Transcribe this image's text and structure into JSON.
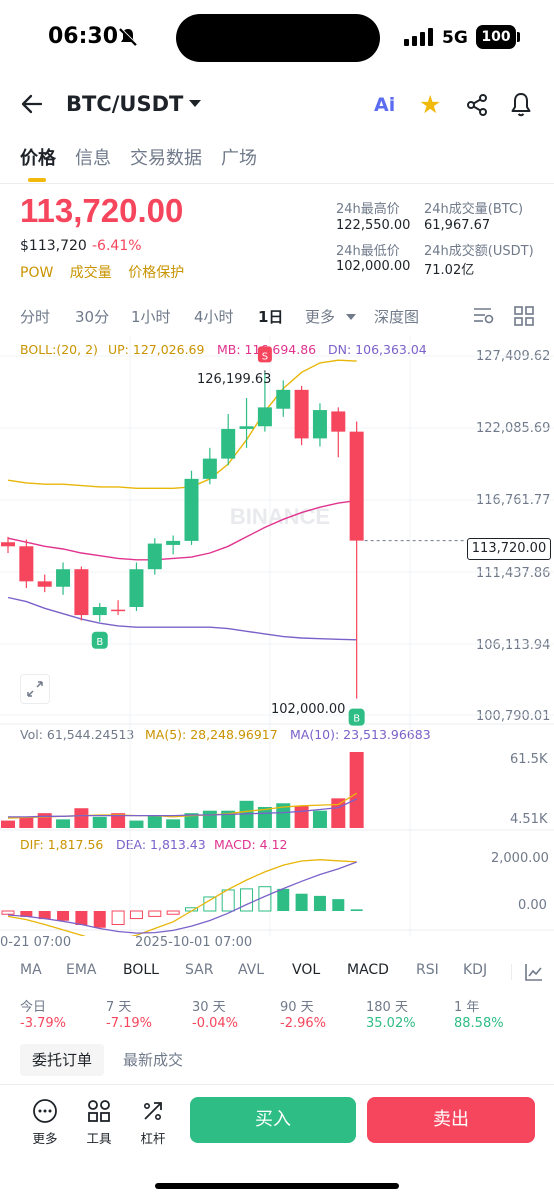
{
  "status_bar": {
    "time": "06:30",
    "network": "5G",
    "battery": "100"
  },
  "header": {
    "pair": "BTC/USDT",
    "ai_label": "Ai"
  },
  "tabs": [
    "价格",
    "信息",
    "交易数据",
    "广场"
  ],
  "price": {
    "last": "113,720.00",
    "usd": "$113,720",
    "change": "-6.41%",
    "tags": [
      "POW",
      "成交量",
      "价格保护"
    ]
  },
  "stats": {
    "high_label": "24h最高价",
    "high": "122,550.00",
    "vol_btc_label": "24h成交量(BTC)",
    "vol_btc": "61,967.67",
    "low_label": "24h最低价",
    "low": "102,000.00",
    "vol_usdt_label": "24h成交额(USDT)",
    "vol_usdt": "71.02亿"
  },
  "intervals": [
    "分时",
    "30分",
    "1小时",
    "4小时",
    "1日",
    "更多",
    "深度图"
  ],
  "active_interval": "1日",
  "boll": {
    "params": "BOLL:(20, 2)",
    "up": "UP: 127,026.69",
    "mb": "MB: 116,694.86",
    "dn": "DN: 106,363.04"
  },
  "vol_legend": {
    "vol": "Vol: 61,544.24513",
    "ma5": "MA(5): 28,248.96917",
    "ma10": "MA(10): 23,513.96683"
  },
  "macd_legend": {
    "dif": "DIF: 1,817.56",
    "dea": "DEA: 1,813.43",
    "macd": "MACD: 4.12"
  },
  "price_axis": [
    "127,409.62",
    "122,085.69",
    "116,761.77",
    "111,437.86",
    "106,113.94",
    "100,790.01"
  ],
  "current_price_tag": "113,720.00",
  "high_marker": "126,199.63",
  "low_marker": "102,000.00",
  "vol_axis": [
    "61.5K",
    "4.51K"
  ],
  "macd_axis": [
    "2,000.00",
    "0.00"
  ],
  "time_axis": [
    "0-21 07:00",
    "2025-10-01 07:00"
  ],
  "watermark": "BINANCE",
  "buy_marker": "B",
  "sell_marker": "S",
  "indicator_tabs": [
    "MA",
    "EMA",
    "BOLL",
    "SAR",
    "AVL",
    "VOL",
    "MACD",
    "RSI",
    "KDJ"
  ],
  "performance": [
    {
      "label": "今日",
      "value": "-3.79%"
    },
    {
      "label": "7 天",
      "value": "-7.19%"
    },
    {
      "label": "30 天",
      "value": "-0.04%"
    },
    {
      "label": "90 天",
      "value": "-2.96%"
    },
    {
      "label": "180 天",
      "value": "35.02%"
    },
    {
      "label": "1 年",
      "value": "88.58%"
    }
  ],
  "order_tabs": [
    "委托订单",
    "最新成交"
  ],
  "tools": [
    "更多",
    "工具",
    "杠杆"
  ],
  "buy": "买入",
  "sell": "卖出",
  "colors": {
    "up": "#2ebd85",
    "down": "#f6465d",
    "accent": "#f0b90b",
    "boll_up": "#e8b608",
    "boll_mb": "#e0338f",
    "boll_dn": "#7b61c9"
  },
  "candles": [
    {
      "o": 113600,
      "h": 114000,
      "l": 112800,
      "c": 113300
    },
    {
      "o": 113300,
      "h": 113800,
      "l": 110200,
      "c": 110700
    },
    {
      "o": 110700,
      "h": 111200,
      "l": 109900,
      "c": 110300
    },
    {
      "o": 110300,
      "h": 112100,
      "l": 109700,
      "c": 111600
    },
    {
      "o": 111600,
      "h": 111800,
      "l": 107800,
      "c": 108200
    },
    {
      "o": 108200,
      "h": 109100,
      "l": 107700,
      "c": 108800
    },
    {
      "o": 108600,
      "h": 109300,
      "l": 108200,
      "c": 108500
    },
    {
      "o": 108800,
      "h": 112100,
      "l": 108500,
      "c": 111600
    },
    {
      "o": 111600,
      "h": 113900,
      "l": 111200,
      "c": 113500
    },
    {
      "o": 113400,
      "h": 114100,
      "l": 112700,
      "c": 113700
    },
    {
      "o": 113700,
      "h": 118900,
      "l": 113400,
      "c": 118300
    },
    {
      "o": 118300,
      "h": 120600,
      "l": 117900,
      "c": 119800
    },
    {
      "o": 119800,
      "h": 123100,
      "l": 119300,
      "c": 122000
    },
    {
      "o": 122000,
      "h": 124300,
      "l": 120600,
      "c": 122200
    },
    {
      "o": 122200,
      "h": 126199,
      "l": 121800,
      "c": 123600
    },
    {
      "o": 123500,
      "h": 125600,
      "l": 122900,
      "c": 124900
    },
    {
      "o": 124900,
      "h": 125200,
      "l": 120800,
      "c": 121300
    },
    {
      "o": 121300,
      "h": 123900,
      "l": 120700,
      "c": 123400
    },
    {
      "o": 123300,
      "h": 123600,
      "l": 119900,
      "c": 121800
    },
    {
      "o": 121800,
      "h": 122550,
      "l": 102000,
      "c": 113720
    }
  ],
  "volumes": [
    6,
    9,
    12,
    7,
    16,
    9,
    12,
    6,
    10,
    7,
    12,
    14,
    14,
    22,
    17,
    20,
    18,
    14,
    24,
    61.5
  ]
}
